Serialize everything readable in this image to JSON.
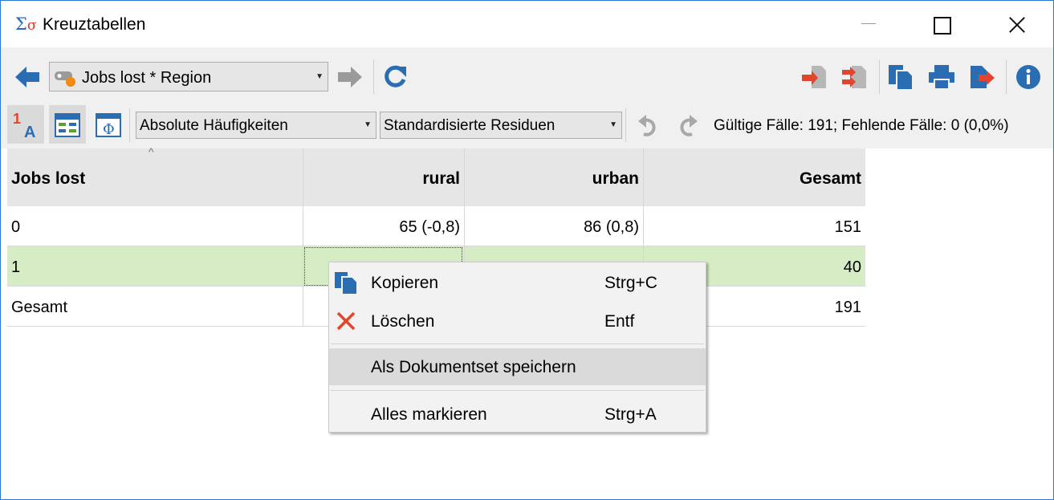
{
  "window": {
    "title": "Kreuztabellen",
    "icon_glyph_main": "Σ",
    "icon_glyph_small": "σ"
  },
  "toolbar": {
    "nav_selected": "Jobs lost * Region",
    "frequency_selected": "Absolute Häufigkeiten",
    "residual_selected": "Standardisierte Residuen",
    "status": "Gültige Fälle: 191;  Fehlende Fälle: 0 (0,0%)",
    "icons": [
      "back-arrow-icon",
      "variable-icon",
      "forward-arrow-icon",
      "refresh-icon",
      "export-icon",
      "export-multiple-icon",
      "copy-icon",
      "print-icon",
      "export-exit-icon",
      "info-icon",
      "sort-1a-icon",
      "table-layout-icon",
      "phi-icon",
      "undo-icon",
      "redo-icon"
    ]
  },
  "table": {
    "headers": [
      "Jobs lost",
      "rural",
      "urban",
      "Gesamt"
    ],
    "rows": [
      [
        "0",
        "65 (-0,8)",
        "86 (0,8)",
        "151"
      ],
      [
        "1",
        "",
        "",
        "40"
      ],
      [
        "Gesamt",
        "",
        "",
        "191"
      ]
    ]
  },
  "context_menu": {
    "items": [
      {
        "label": "Kopieren",
        "shortcut": "Strg+C",
        "icon": "copy-icon"
      },
      {
        "label": "Löschen",
        "shortcut": "Entf",
        "icon": "delete-icon"
      },
      {
        "label": "Als Dokumentset speichern",
        "shortcut": ""
      },
      {
        "label": "Alles markieren",
        "shortcut": "Strg+A"
      }
    ]
  },
  "colors": {
    "accent_blue": "#2a6db3",
    "selected_row": "#d6ecc4",
    "export_red": "#e2452c"
  }
}
